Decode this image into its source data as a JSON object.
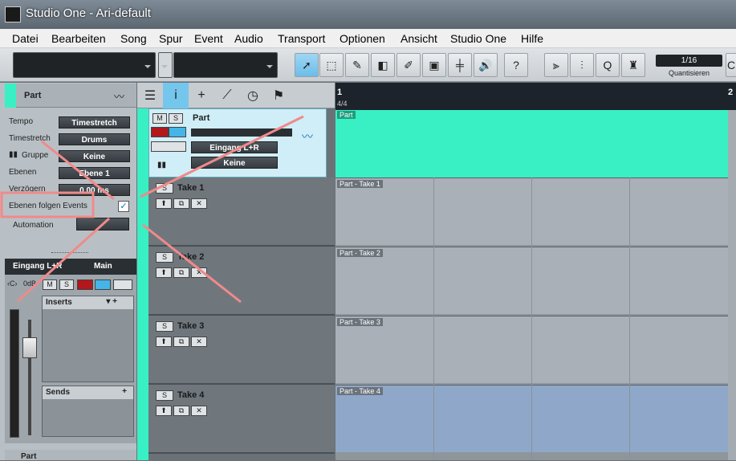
{
  "window": {
    "title": "Studio One - Ari-default"
  },
  "menu": [
    "Datei",
    "Bearbeiten",
    "Song",
    "Spur",
    "Event",
    "Audio",
    "Transport",
    "Optionen",
    "Ansicht",
    "Studio One",
    "Hilfe"
  ],
  "toolbar": {
    "quantize_value": "1/16",
    "quantize_label": "Quantisieren",
    "help": "?",
    "q": "Q",
    "partial": "C"
  },
  "inspector": {
    "title": "Part",
    "rows": [
      {
        "label": "Tempo",
        "value": "Timestretch"
      },
      {
        "label": "Timestretch",
        "value": "Drums"
      },
      {
        "label": "Gruppe",
        "value": "Keine"
      },
      {
        "label": "Ebenen",
        "value": "Ebene 1"
      },
      {
        "label": "Verzögern",
        "value": "0.00 ms"
      }
    ],
    "follow_label": "Ebenen folgen Events",
    "automation_label": "Automation",
    "io_tabs": [
      "Eingang L+R",
      "Main"
    ],
    "pan_label": "0dB",
    "inserts_label": "Inserts",
    "sends_label": "Sends",
    "bottom_label": "Part"
  },
  "track": {
    "name": "Part",
    "m": "M",
    "s": "S",
    "input": "Eingang L+R",
    "group": "Keine"
  },
  "takes": [
    {
      "name": "Take 1",
      "event": "Part - Take 1"
    },
    {
      "name": "Take 2",
      "event": "Part - Take 2"
    },
    {
      "name": "Take 3",
      "event": "Part - Take 3"
    },
    {
      "name": "Take 4",
      "event": "Part - Take 4"
    }
  ],
  "ruler": {
    "bar1": "1",
    "bar2": "2",
    "sig": "4/4"
  },
  "part_event": "Part",
  "colors": {
    "accent": "#39f0c4",
    "active_tool": "#6cbde8",
    "annotation": "#f08a8a"
  }
}
